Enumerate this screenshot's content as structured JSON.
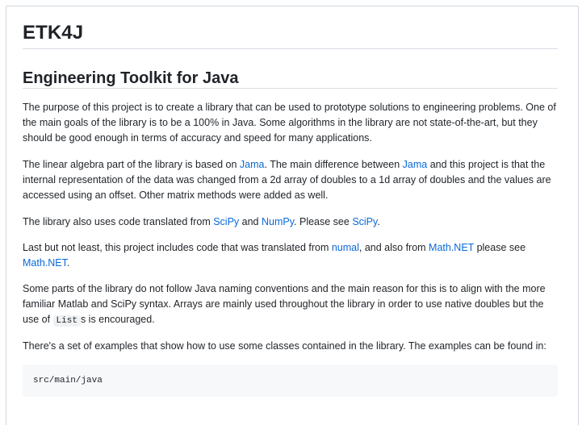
{
  "readme": {
    "title": "ETK4J",
    "subtitle": "Engineering Toolkit for Java",
    "p1": "The purpose of this project is to create a library that can be used to prototype solutions to engineering problems. One of the main goals of the library is to be a 100% in Java. Some algorithms in the library are not state-of-the-art, but they should be good enough in terms of accuracy and speed for many applications.",
    "p2": {
      "t1": "The linear algebra part of the library is based on ",
      "link1": "Jama",
      "t2": ". The main difference between ",
      "link2": "Jama",
      "t3": " and this project is that the internal representation of the data was changed from a 2d array of doubles to a 1d array of doubles and the values are accessed using an offset. Other matrix methods were added as well."
    },
    "p3": {
      "t1": "The library also uses code translated from ",
      "link1": "SciPy",
      "t2": " and ",
      "link2": "NumPy",
      "t3": ". Please see ",
      "link3": "SciPy",
      "t4": "."
    },
    "p4": {
      "t1": "Last but not least, this project includes code that was translated from ",
      "link1": "numal",
      "t2": ", and also from ",
      "link2": "Math.NET",
      "t3": " please see ",
      "link3": "Math.NET",
      "t4": "."
    },
    "p5": {
      "t1": "Some parts of the library do not follow Java naming conventions and the main reason for this is to align with the more familiar Matlab and SciPy syntax. Arrays are mainly used throughout the library in order to use native doubles but the use of ",
      "code": "List",
      "t2": "s is encouraged."
    },
    "p6": "There's a set of examples that show how to use some classes contained in the library. The examples can be found in:",
    "code_block": "src/main/java"
  },
  "colors": {
    "link": "#0969da",
    "text": "#1f2328",
    "code_bg": "#f6f8fa",
    "rule": "#d8dee4"
  }
}
